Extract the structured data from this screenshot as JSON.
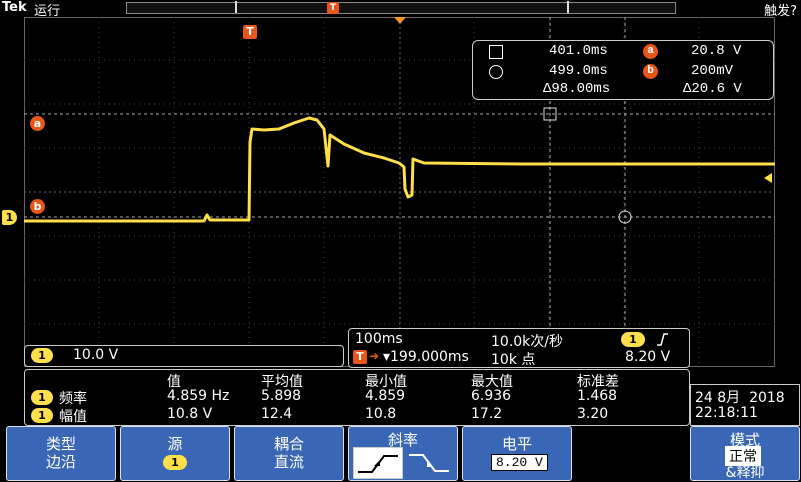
{
  "header": {
    "brand": "Tek",
    "run_state": "运行",
    "trigger_status": "触发?"
  },
  "channel_markers": {
    "ch1": "1",
    "ref_a": "a",
    "ref_b": "b",
    "trigger_T": "T"
  },
  "cursor_readout": {
    "row1_time": "401.0ms",
    "row1_value": "20.8 V",
    "row2_time": "499.0ms",
    "row2_value": "200mV",
    "delta_time": "Δ98.00ms",
    "delta_value": "Δ20.6 V"
  },
  "horizontal": {
    "timebase": "100ms",
    "sample_rate": "10.0k次/秒",
    "trigger_position": "▾199.000ms",
    "record_length": "10k 点",
    "trigger_channel": "1",
    "trigger_slope_icon": "rising-edge",
    "trigger_level": "8.20 V"
  },
  "ch1": {
    "label": "1",
    "scale": "10.0 V"
  },
  "measurements": {
    "headers": [
      "值",
      "平均值",
      "最小值",
      "最大值",
      "标准差"
    ],
    "rows": [
      {
        "ch": "1",
        "name": "频率",
        "values": [
          "4.859 Hz",
          "5.898",
          "4.859",
          "6.936",
          "1.468"
        ]
      },
      {
        "ch": "1",
        "name": "幅值",
        "values": [
          "10.8 V",
          "12.4",
          "10.8",
          "17.2",
          "3.20"
        ]
      }
    ]
  },
  "datetime": {
    "date": "24 8月  2018",
    "time": "22:18:11"
  },
  "menu": {
    "type": {
      "title": "类型",
      "value": "边沿"
    },
    "source": {
      "title": "源",
      "value": "1"
    },
    "coupling": {
      "title": "耦合",
      "value": "直流"
    },
    "slope": {
      "title": "斜率"
    },
    "level": {
      "title": "电平",
      "value": "8.20 V"
    },
    "mode": {
      "title": "模式",
      "value1": "正常",
      "value2": "&释抑"
    }
  },
  "colors": {
    "ch1": "#ffe04a",
    "ref": "#e8571a",
    "menu_bg": "#3a67b5",
    "grid": "#555555"
  }
}
